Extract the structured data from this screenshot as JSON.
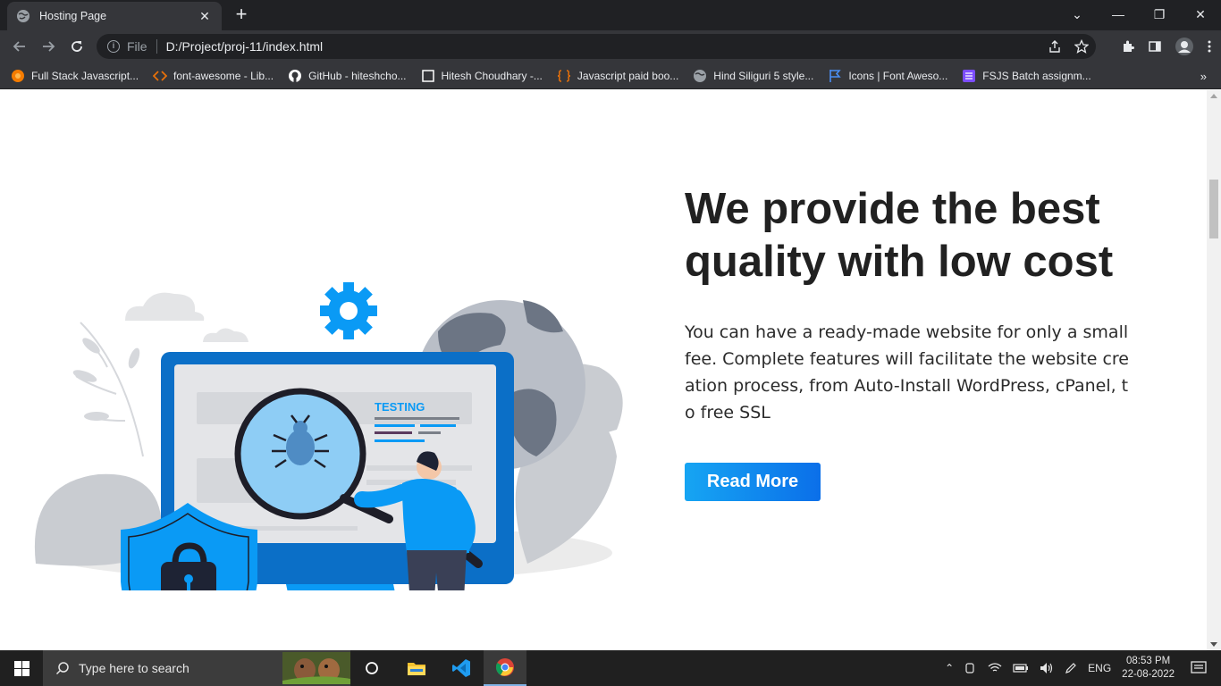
{
  "browser": {
    "tab_title": "Hosting Page",
    "tab_close": "✕",
    "new_tab": "+",
    "scheme": "File",
    "url": "D:/Project/proj-11/index.html",
    "window_controls": {
      "collapse": "⌄",
      "minimize": "—",
      "restore": "❐",
      "close": "✕"
    }
  },
  "bookmarks": [
    {
      "label": "Full Stack Javascript...",
      "icon": "orange-circle-icon",
      "color": "#f57c00"
    },
    {
      "label": "font-awesome - Lib...",
      "icon": "code-brackets-icon",
      "color": "#e8710a"
    },
    {
      "label": "GitHub - hiteshcho...",
      "icon": "github-icon",
      "color": "#ffffff"
    },
    {
      "label": "Hitesh Choudhary -...",
      "icon": "square-icon",
      "color": "#ffffff"
    },
    {
      "label": "Javascript paid boo...",
      "icon": "code-braces-icon",
      "color": "#e8710a"
    },
    {
      "label": "Hind Siliguri 5 style...",
      "icon": "globe-icon",
      "color": "#9aa0a6"
    },
    {
      "label": "Icons | Font Aweso...",
      "icon": "flag-icon",
      "color": "#4a8ef5"
    },
    {
      "label": "FSJS Batch assignm...",
      "icon": "list-icon",
      "color": "#7c4dff"
    }
  ],
  "bookmarks_more": "»",
  "hero": {
    "headline": "We provide the best quality with low cost",
    "description": "You can have a ready-made website for only a small fee. Complete features will facilitate the website creation process, from Auto-Install WordPress, cPanel, to free SSL",
    "button_label": "Read More",
    "illustration_text": "TESTING"
  },
  "taskbar": {
    "search_placeholder": "Type here to search",
    "language": "ENG",
    "time": "08:53 PM",
    "date": "22-08-2022"
  },
  "colors": {
    "accent_blue": "#0a9af5",
    "dark_blue": "#0b6fe9",
    "headline": "#212121",
    "chrome_dark": "#202124",
    "chrome_mid": "#35363a"
  }
}
